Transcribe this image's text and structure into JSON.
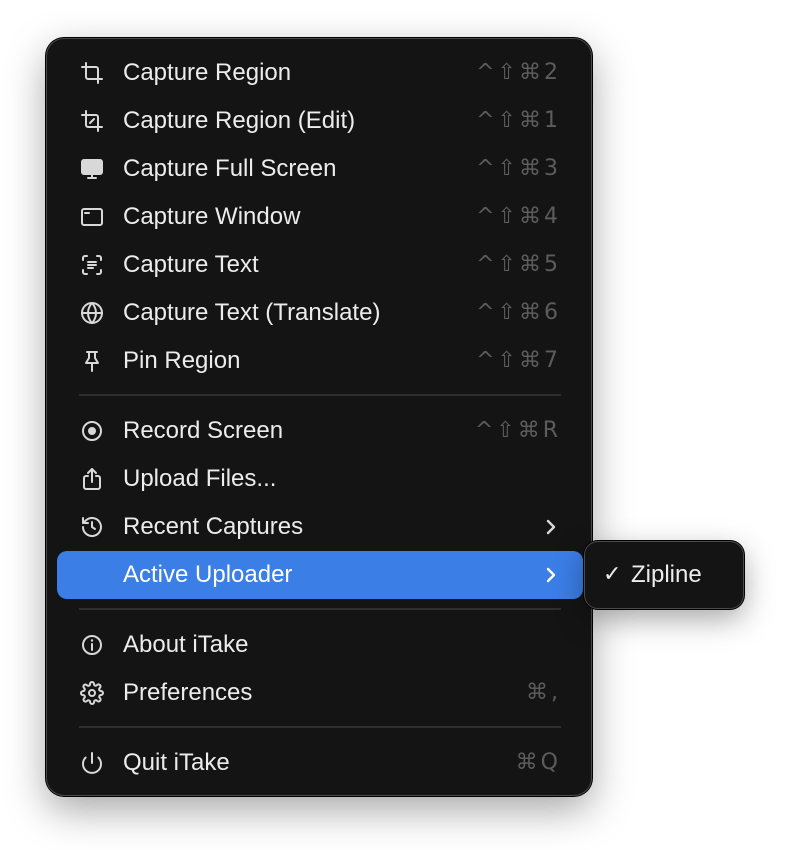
{
  "menu": {
    "items": [
      {
        "label": "Capture Region",
        "shortcut": "^⇧⌘2",
        "icon": "crop-icon"
      },
      {
        "label": "Capture Region (Edit)",
        "shortcut": "^⇧⌘1",
        "icon": "crop-edit-icon"
      },
      {
        "label": "Capture Full Screen",
        "shortcut": "^⇧⌘3",
        "icon": "display-icon"
      },
      {
        "label": "Capture Window",
        "shortcut": "^⇧⌘4",
        "icon": "window-icon"
      },
      {
        "label": "Capture Text",
        "shortcut": "^⇧⌘5",
        "icon": "text-viewfinder-icon"
      },
      {
        "label": "Capture Text (Translate)",
        "shortcut": "^⇧⌘6",
        "icon": "globe-icon"
      },
      {
        "label": "Pin Region",
        "shortcut": "^⇧⌘7",
        "icon": "pin-icon"
      },
      {
        "label": "Record Screen",
        "shortcut": "^⇧⌘R",
        "icon": "record-icon"
      },
      {
        "label": "Upload Files...",
        "shortcut": "",
        "icon": "upload-icon"
      },
      {
        "label": "Recent Captures",
        "shortcut": "",
        "icon": "history-icon"
      },
      {
        "label": "Active Uploader",
        "shortcut": "",
        "icon": ""
      },
      {
        "label": "About iTake",
        "shortcut": "",
        "icon": "info-icon"
      },
      {
        "label": "Preferences",
        "shortcut": "⌘,",
        "icon": "gear-icon"
      },
      {
        "label": "Quit iTake",
        "shortcut": "⌘Q",
        "icon": "power-icon"
      }
    ]
  },
  "submenu": {
    "check": "✓",
    "label": "Zipline"
  },
  "colors": {
    "menu_background": "#141414",
    "highlight": "#3b7ee6",
    "text": "#ececec",
    "shortcut_text": "#5c5c5c"
  }
}
